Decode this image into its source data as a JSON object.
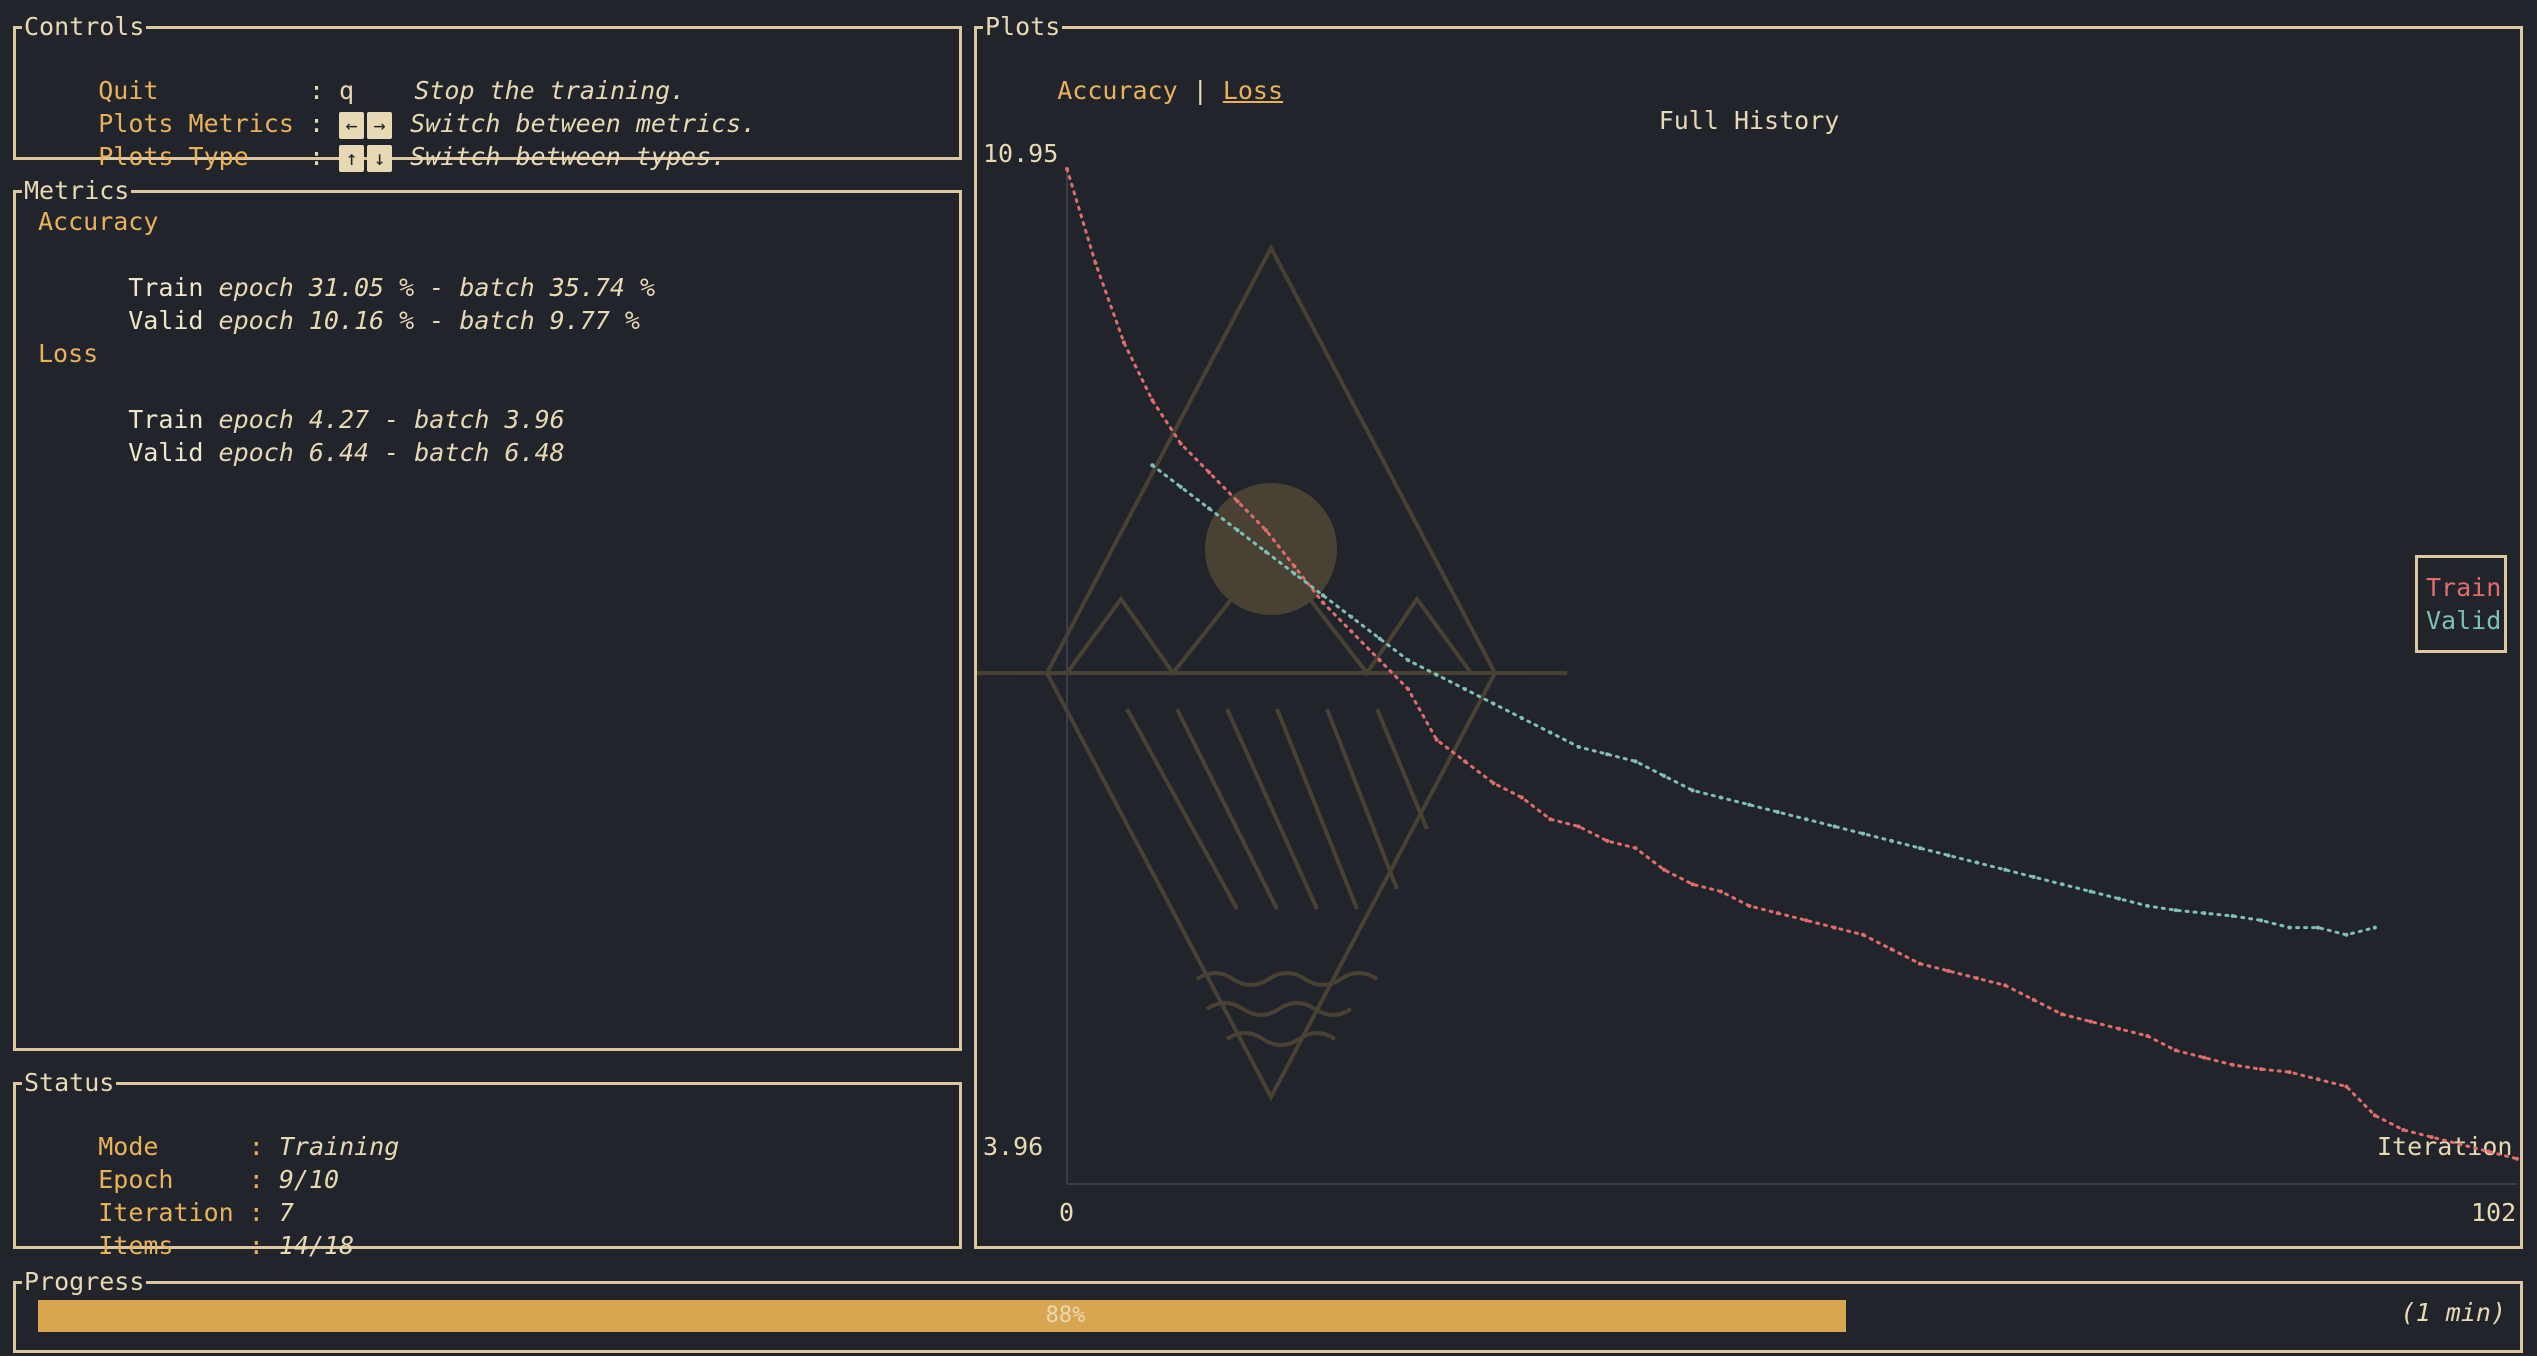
{
  "controls": {
    "title": "Controls",
    "rows": [
      {
        "label": "Quit         :",
        "key": "q",
        "desc": "Stop the training."
      },
      {
        "label": "Plots Metrics :",
        "key": "",
        "desc": "Switch between metrics."
      },
      {
        "label": "Plots Type    :",
        "key": "",
        "desc": "Switch between types."
      }
    ]
  },
  "metrics": {
    "title": "Metrics",
    "accuracy_label": "Accuracy",
    "acc_train_label": "Train",
    "acc_train_value": "epoch 31.05 % - batch 35.74 %",
    "acc_valid_label": "Valid",
    "acc_valid_value": "epoch 10.16 % - batch 9.77 %",
    "loss_label": "Loss",
    "loss_train_label": "Train",
    "loss_train_value": "epoch 4.27 - batch 3.96",
    "loss_valid_label": "Valid",
    "loss_valid_value": "epoch 6.44 - batch 6.48"
  },
  "status": {
    "title": "Status",
    "mode_label": "Mode      :",
    "mode_value": "Training",
    "epoch_label": "Epoch     :",
    "epoch_value": "9/10",
    "iteration_label": "Iteration :",
    "iteration_value": "7",
    "items_label": "Items     :",
    "items_value": "14/18"
  },
  "plots": {
    "title": "Plots",
    "tab_accuracy": "Accuracy",
    "tab_separator": "|",
    "tab_loss": "Loss",
    "legend_train": "Train",
    "legend_valid": "Valid"
  },
  "progress": {
    "title": "Progress",
    "percent_label": "88%",
    "percent_value": 0.88,
    "eta": "(1 min)"
  },
  "colors": {
    "train": "#e06c6c",
    "valid": "#7fbfb5",
    "accent": "#e8b15a"
  },
  "chart_data": {
    "type": "line",
    "title": "Full History",
    "xlabel": "Iteration",
    "ylabel": "",
    "xlim": [
      0,
      102
    ],
    "ylim": [
      3.96,
      10.95
    ],
    "x_ticks": [
      "0",
      "102"
    ],
    "y_ticks": [
      "10.95",
      "3.96"
    ],
    "legend_placement": "right",
    "series": [
      {
        "name": "Train",
        "color": "#e06c6c",
        "x": [
          0,
          2,
          4,
          6,
          8,
          10,
          12,
          14,
          16,
          18,
          20,
          22,
          24,
          26,
          28,
          30,
          32,
          34,
          36,
          38,
          40,
          42,
          44,
          46,
          48,
          50,
          52,
          54,
          56,
          58,
          60,
          62,
          64,
          66,
          68,
          70,
          72,
          74,
          76,
          78,
          80,
          82,
          84,
          86,
          88,
          90,
          92,
          94,
          96,
          98,
          100,
          102
        ],
        "y": [
          10.95,
          10.3,
          9.75,
          9.35,
          9.05,
          8.85,
          8.65,
          8.45,
          8.2,
          7.95,
          7.75,
          7.55,
          7.35,
          7.0,
          6.85,
          6.7,
          6.6,
          6.45,
          6.4,
          6.3,
          6.25,
          6.1,
          6.0,
          5.95,
          5.85,
          5.8,
          5.75,
          5.7,
          5.65,
          5.55,
          5.45,
          5.4,
          5.35,
          5.3,
          5.2,
          5.1,
          5.05,
          5.0,
          4.95,
          4.85,
          4.8,
          4.75,
          4.72,
          4.7,
          4.65,
          4.6,
          4.4,
          4.3,
          4.25,
          4.2,
          4.15,
          4.1
        ]
      },
      {
        "name": "Valid",
        "color": "#7fbfb5",
        "x": [
          6,
          8,
          10,
          12,
          14,
          16,
          18,
          20,
          22,
          24,
          26,
          28,
          30,
          32,
          34,
          36,
          38,
          40,
          42,
          44,
          46,
          48,
          50,
          52,
          54,
          56,
          58,
          60,
          62,
          64,
          66,
          68,
          70,
          72,
          74,
          76,
          78,
          80,
          82,
          84,
          86,
          88,
          90,
          92
        ],
        "y": [
          8.9,
          8.75,
          8.6,
          8.45,
          8.3,
          8.15,
          8.0,
          7.85,
          7.7,
          7.55,
          7.45,
          7.35,
          7.25,
          7.15,
          7.05,
          6.95,
          6.9,
          6.85,
          6.75,
          6.65,
          6.6,
          6.55,
          6.5,
          6.45,
          6.4,
          6.35,
          6.3,
          6.25,
          6.2,
          6.15,
          6.1,
          6.05,
          6.0,
          5.95,
          5.9,
          5.85,
          5.82,
          5.8,
          5.78,
          5.75,
          5.7,
          5.7,
          5.65,
          5.7
        ]
      }
    ]
  }
}
